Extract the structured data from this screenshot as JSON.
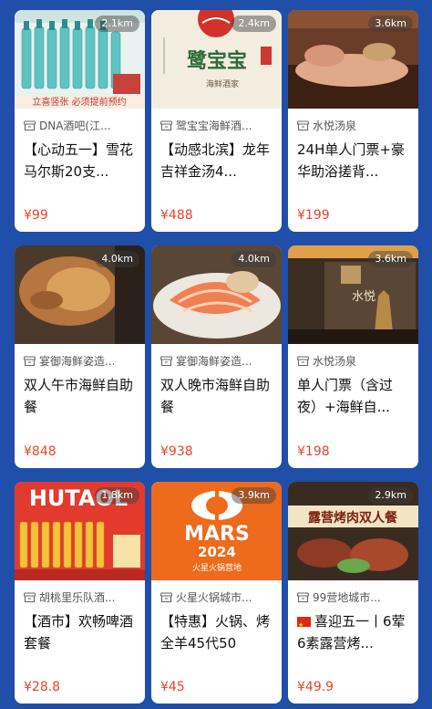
{
  "cards": [
    {
      "distance": "2.1km",
      "shop": "DNA酒吧(江...",
      "title": "【心动五一】雪花马尔斯20支...",
      "price": "¥99",
      "image_text": "立喜竖张 必须提前预约"
    },
    {
      "distance": "2.4km",
      "shop": "鹭宝宝海鲜酒...",
      "title": "【动感北滨】龙年吉祥金汤4...",
      "price": "¥488",
      "image_text": "鹭宝宝",
      "image_subtext": "海鲜酒家"
    },
    {
      "distance": "3.6km",
      "shop": "水悦汤泉",
      "title": "24H单人门票+豪华助浴搓背...",
      "price": "¥199"
    },
    {
      "distance": "4.0km",
      "shop": "宴御海鲜姿造...",
      "title": "双人午市海鲜自助餐",
      "price": "¥848"
    },
    {
      "distance": "4.0km",
      "shop": "宴御海鲜姿造...",
      "title": "双人晚市海鲜自助餐",
      "price": "¥938"
    },
    {
      "distance": "3.6km",
      "shop": "水悦汤泉",
      "title": "单人门票（含过夜）+海鲜自...",
      "price": "¥198",
      "image_text": "水悦"
    },
    {
      "distance": "1.8km",
      "shop": "胡桃里乐队酒...",
      "title": "【酒市】欢畅啤酒套餐",
      "price": "¥28.8",
      "image_text": "HUTAOL"
    },
    {
      "distance": "3.9km",
      "shop": "火星火锅城市...",
      "title": "【特惠】火锅、烤全羊45代50",
      "price": "¥45",
      "image_text": "MARS",
      "image_subtext": "2024",
      "image_caption": "火星火锅营地"
    },
    {
      "distance": "2.9km",
      "shop": "99营地城市...",
      "title": "喜迎五一丨6荤6素露营烤...",
      "price": "¥49.9",
      "flag": true,
      "image_text": "露营烤肉双人餐"
    }
  ],
  "colors": {
    "background": "#1f4fa8",
    "price": "#e8442d",
    "card": "#ffffff"
  },
  "icons": {
    "shop": "shop-icon",
    "flag": "china-flag-icon"
  }
}
